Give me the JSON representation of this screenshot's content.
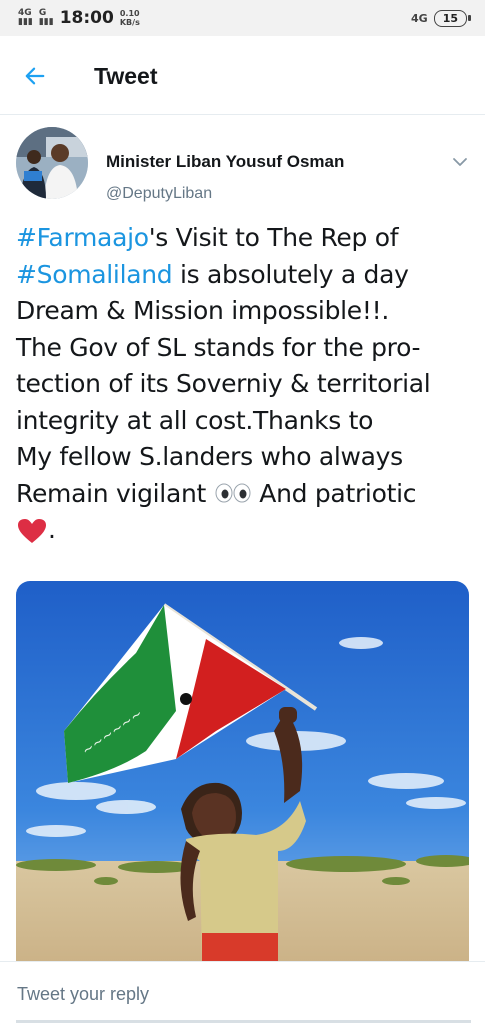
{
  "status_bar": {
    "signal_1": "4G",
    "signal_2": "G",
    "time": "18:00",
    "net_speed": "0.10",
    "net_unit": "KB/s",
    "right_network": "4G",
    "battery": "15"
  },
  "header": {
    "title": "Tweet"
  },
  "tweet": {
    "author_name": "Minister Liban Yousuf Osman",
    "author_handle": "@DeputyLiban",
    "lines": [
      {
        "hashtag": "#Farmaajo",
        "rest": "'s Visit to The Rep of"
      },
      {
        "hashtag": "#Somaliland",
        "rest": " is absolutely a day"
      },
      {
        "text": "Dream & Mission impossible!!."
      },
      {
        "text": "The  Gov of SL stands for the pro-"
      },
      {
        "text": "tection of its Soverniy & territorial"
      },
      {
        "text": "integrity at all cost.Thanks to"
      },
      {
        "text": "My fellow S.landers who always"
      },
      {
        "before_emoji": "Remain vigilant ",
        "after_emoji": " And patriotic"
      },
      {
        "after_heart": "."
      }
    ]
  },
  "reply": {
    "placeholder": "Tweet your reply"
  },
  "colors": {
    "link": "#1b95e0",
    "text": "#14171a",
    "secondary": "#657786"
  }
}
